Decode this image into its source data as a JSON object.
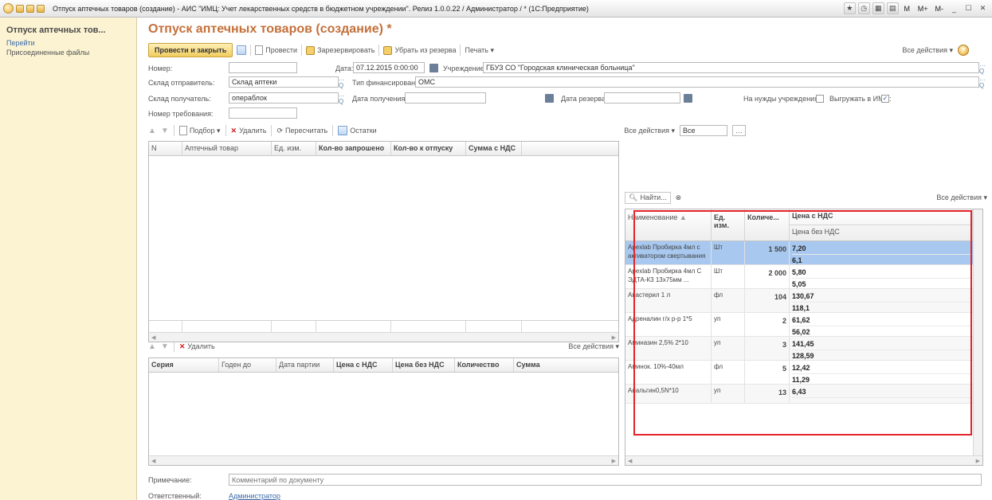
{
  "window": {
    "title": "Отпуск аптечных товаров (создание) - АИС \"ИМЦ: Учет лекарственных средств в бюджетном учреждении\". Релиз 1.0.0.22 / Администратор / * (1С:Предприятие)",
    "right_buttons": [
      "M",
      "M+",
      "M-"
    ]
  },
  "sidebar": {
    "title": "Отпуск аптечных тов...",
    "items": [
      "Перейти",
      "Присоединенные файлы"
    ]
  },
  "page": {
    "title": "Отпуск аптечных товаров (создание) *"
  },
  "toolbar": {
    "post_close": "Провести и закрыть",
    "post": "Провести",
    "reserve": "Зарезервировать",
    "unreserve": "Убрать из резерва",
    "print": "Печать ▾",
    "all_actions": "Все действия ▾"
  },
  "form": {
    "number_label": "Номер:",
    "number_value": "",
    "date_label": "Дата:",
    "date_value": "07.12.2015 0:00:00",
    "org_label": "Учреждение:",
    "org_value": "ГБУЗ СО \"Городская клиническая больница\"",
    "sender_label": "Склад отправитель:",
    "sender_value": "Склад аптеки",
    "fin_label": "Тип финансирования:",
    "fin_value": "ОМС",
    "receiver_label": "Склад получатель:",
    "receiver_value": "операблок",
    "recv_date_label": "Дата получения:",
    "recv_date_value": "",
    "reserve_date_label": "Дата резерва:",
    "reserve_date_value": "",
    "needs_label": "На нужды учреждения:",
    "upload_label": "Выгружать в ИМС:",
    "req_label": "Номер требования:",
    "req_value": ""
  },
  "items_table": {
    "toolbar": {
      "select": "Подбор ▾",
      "delete": "Удалить",
      "recalc": "Пересчитать",
      "stock": "Остатки",
      "all_actions": "Все действия ▾",
      "filter_value": "Все"
    },
    "columns": [
      "N",
      "Аптечный товар",
      "Ед. изм.",
      "Кол-во запрошено",
      "Кол-во к отпуску",
      "Сумма с НДС"
    ]
  },
  "series_table": {
    "toolbar": {
      "delete": "Удалить",
      "all_actions": "Все действия ▾"
    },
    "columns": [
      "Серия",
      "Годен до",
      "Дата партии",
      "Цена с НДС",
      "Цена без НДС",
      "Количество",
      "Сумма"
    ]
  },
  "stock_table": {
    "find": "Найти...",
    "all_actions": "Все действия ▾",
    "columns": {
      "name": "Наименование",
      "unit": "Ед. изм.",
      "qty": "Количе...",
      "price_vat": "Цена с НДС",
      "price_novat": "Цена без НДС"
    },
    "rows": [
      {
        "name": "Apexlab Пробирка  4мл с активатором свертывания ...",
        "unit": "Шт",
        "qty": "1 500",
        "price_vat": "7,20",
        "price_novat": "6,1"
      },
      {
        "name": "Apexlab Пробирка  4мл С ЭДТА-К3  13х75мм ...",
        "unit": "Шт",
        "qty": "2 000",
        "price_vat": "5,80",
        "price_novat": "5,05"
      },
      {
        "name": "Авастерил 1 л",
        "unit": "фл",
        "qty": "104",
        "price_vat": "130,67",
        "price_novat": "118,1"
      },
      {
        "name": "Адреналин г/х р-р 1*5",
        "unit": "уп",
        "qty": "2",
        "price_vat": "61,62",
        "price_novat": "56,02"
      },
      {
        "name": "Аминазин 2,5% 2*10",
        "unit": "уп",
        "qty": "3",
        "price_vat": "141,45",
        "price_novat": "128,59"
      },
      {
        "name": "Аминок. 10%-40мл",
        "unit": "фл",
        "qty": "5",
        "price_vat": "12,42",
        "price_novat": "11,29"
      },
      {
        "name": "Анальгин0,5N*10",
        "unit": "уп",
        "qty": "13",
        "price_vat": "6,43",
        "price_novat": ""
      }
    ]
  },
  "footer": {
    "note_label": "Примечание:",
    "note_placeholder": "Комментарий по документу",
    "resp_label": "Ответственный:",
    "resp_value": "Администратор"
  }
}
